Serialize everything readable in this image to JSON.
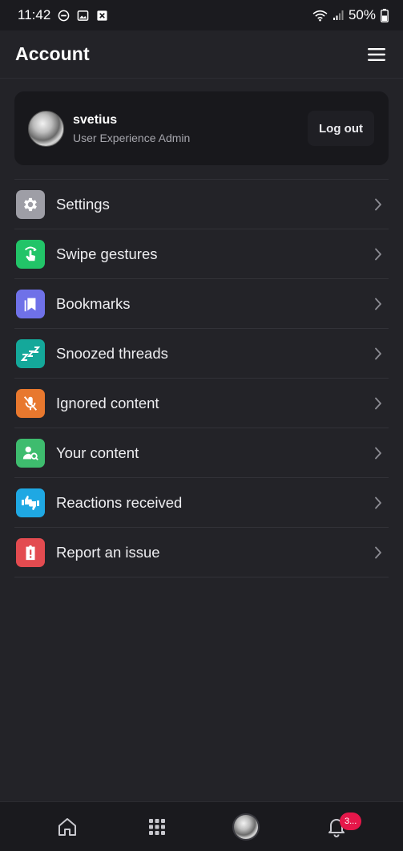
{
  "status_bar": {
    "time": "11:42",
    "battery": "50%",
    "left_icons": [
      "dnd-icon",
      "image-icon",
      "close-box-icon"
    ],
    "right_icons": [
      "wifi-icon",
      "signal-icon",
      "battery-icon"
    ]
  },
  "header": {
    "title": "Account",
    "menu_icon": "hamburger-icon"
  },
  "user_card": {
    "username": "svetius",
    "role": "User Experience Admin",
    "logout_label": "Log out"
  },
  "menu": {
    "items": [
      {
        "label": "Settings",
        "icon": "gear-icon",
        "color": "#9e9ea6"
      },
      {
        "label": "Swipe gestures",
        "icon": "swipe-hand-icon",
        "color": "#22c468"
      },
      {
        "label": "Bookmarks",
        "icon": "bookmark-icon",
        "color": "#6f71e8"
      },
      {
        "label": "Snoozed threads",
        "icon": "zzz-icon",
        "color": "#14a89a"
      },
      {
        "label": "Ignored content",
        "icon": "mic-off-icon",
        "color": "#e8782e"
      },
      {
        "label": "Your content",
        "icon": "user-search-icon",
        "color": "#3ebc6e"
      },
      {
        "label": "Reactions received",
        "icon": "thumbs-icon",
        "color": "#1fa8e3"
      },
      {
        "label": "Report an issue",
        "icon": "report-icon",
        "color": "#e34b50"
      }
    ]
  },
  "bottom_nav": {
    "items": [
      "home-icon",
      "apps-grid-icon",
      "profile-avatar",
      "bell-icon"
    ],
    "notification_badge": "3..."
  },
  "colors": {
    "background": "#232328",
    "card": "#18181c",
    "badge": "#e5174a"
  }
}
